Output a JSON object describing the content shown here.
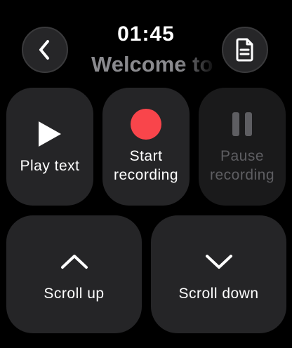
{
  "header": {
    "time": "01:45",
    "subtitle": "Welcome to"
  },
  "tiles": {
    "play": {
      "label": "Play text",
      "icon": "play-icon"
    },
    "record": {
      "label": "Start\nrecording",
      "icon": "record-icon",
      "color": "#f9454b"
    },
    "pause": {
      "label": "Pause\nrecording",
      "icon": "pause-icon",
      "enabled": false
    },
    "scroll_up": {
      "label": "Scroll up",
      "icon": "chevron-up-icon"
    },
    "scroll_down": {
      "label": "Scroll down",
      "icon": "chevron-down-icon"
    }
  },
  "buttons": {
    "back": {
      "icon": "chevron-left-icon"
    },
    "document": {
      "icon": "document-icon"
    }
  }
}
